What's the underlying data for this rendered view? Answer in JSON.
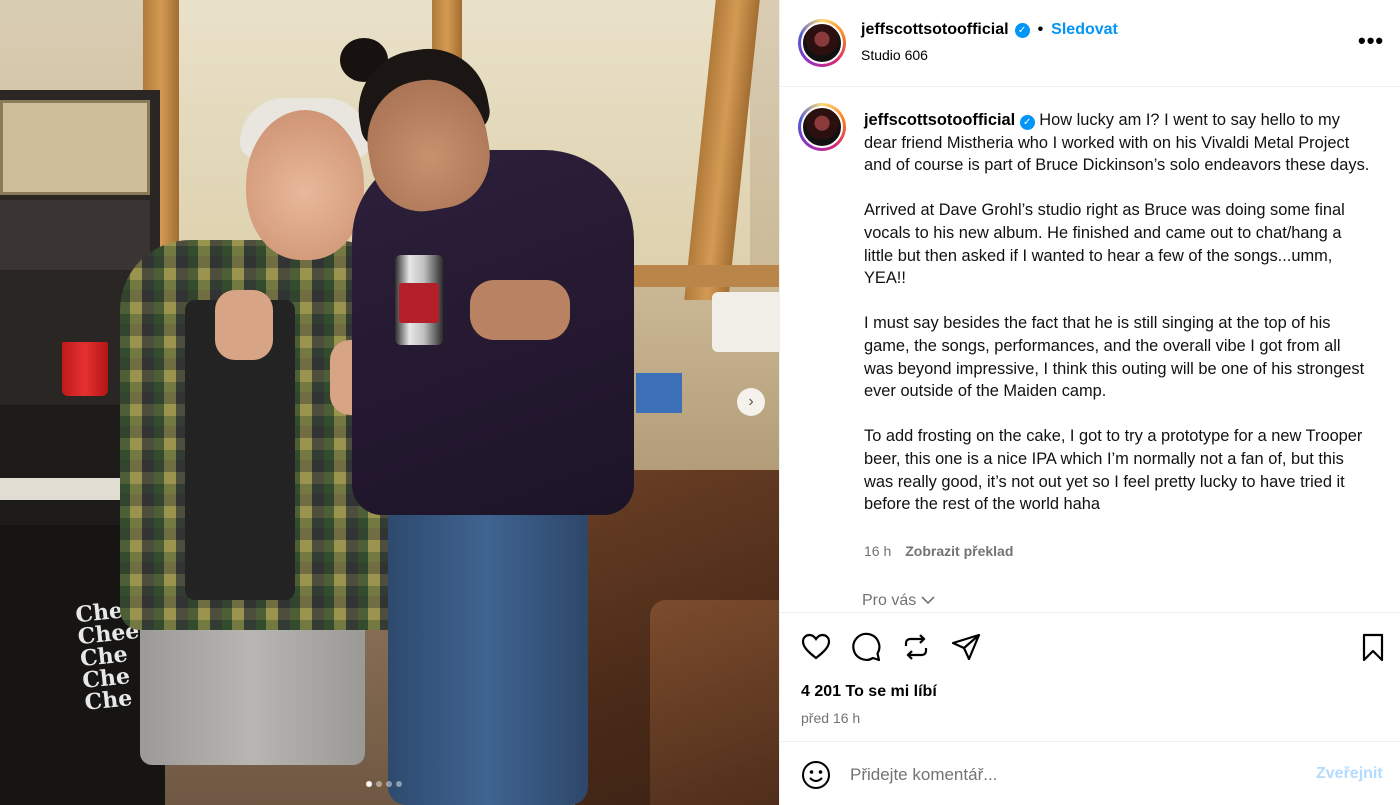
{
  "post": {
    "username": "jeffscottsotoofficial",
    "follow_label": "Sledovat",
    "separator": "•",
    "location": "Studio 606",
    "more_label": "•••"
  },
  "media": {
    "amp_text": "Cheap Chee Che Che Che",
    "carousel_dots": 4,
    "active_dot": 0
  },
  "caption": {
    "username": "jeffscottsotoofficial",
    "paragraphs": [
      "How lucky am I? I went to say hello to my dear friend Mistheria who I worked with on his Vivaldi Metal Project and of course is part of Bruce Dickinson’s solo endeavors these days.",
      "Arrived at Dave Grohl’s studio right as Bruce was doing some final vocals to his new album. He finished and came out to chat/hang a little but then asked if I wanted to hear a few of the songs...umm, YEA!!",
      "I must say besides the fact that he is still singing at the top of his game, the songs, performances, and the overall vibe I got from all was beyond impressive, I think this outing will be one of his strongest ever outside of the Maiden camp.",
      "To add frosting on the cake, I got to try a prototype for a new Trooper beer, this one is a nice IPA which I’m normally not a fan of, but this was really good, it’s not out yet so I feel pretty lucky to have tried it before the rest of the world haha"
    ],
    "time": "16 h",
    "translate_label": "Zobrazit překlad",
    "for_you_label": "Pro vás"
  },
  "actions": {
    "likes": "4 201 To se mi líbí",
    "posted_ago": "před 16 h"
  },
  "comment": {
    "placeholder": "Přidejte komentář...",
    "post_label": "Zveřejnit"
  },
  "colors": {
    "accent": "#0095f6",
    "muted": "#737373",
    "post_disabled": "#b3dbff"
  }
}
